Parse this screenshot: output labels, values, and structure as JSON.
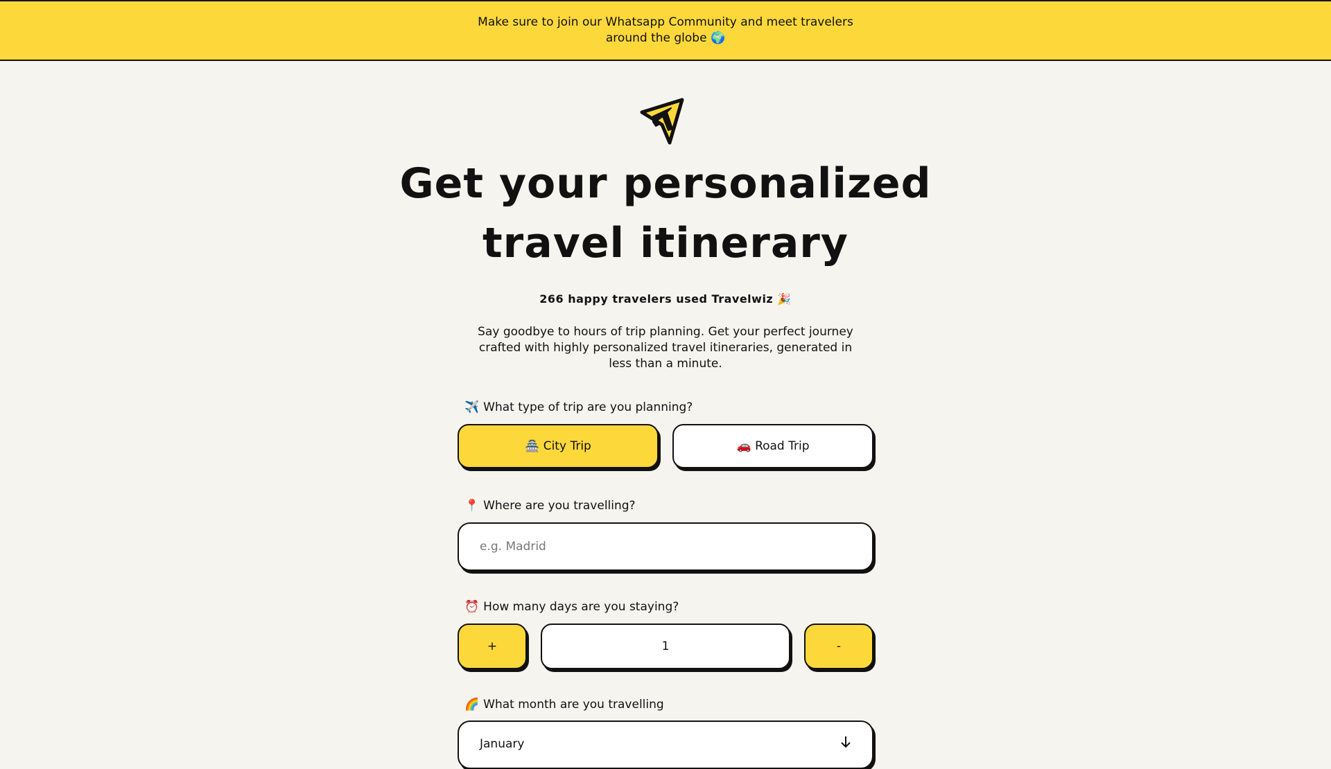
{
  "banner": {
    "text": "Make sure to join our Whatsapp Community and meet travelers around the globe 🌍"
  },
  "hero": {
    "title_line1": "Get your personalized",
    "title_line2": "travel itinerary",
    "count_text": "266 happy travelers used Travelwiz 🎉",
    "intro": "Say goodbye to hours of trip planning. Get your perfect journey crafted with highly personalized travel itineraries, generated in less than a minute."
  },
  "form": {
    "trip_type": {
      "emoji": "✈️",
      "label": "What type of trip are you planning?",
      "options": [
        {
          "emoji": "🏯",
          "label": "City Trip",
          "selected": true
        },
        {
          "emoji": "🚗",
          "label": "Road Trip",
          "selected": false
        }
      ]
    },
    "destination": {
      "emoji": "📍",
      "label": "Where are you travelling?",
      "placeholder": "e.g. Madrid",
      "value": ""
    },
    "days": {
      "emoji": "⏰",
      "label": "How many days are you staying?",
      "plus_label": "+",
      "minus_label": "-",
      "value": "1"
    },
    "month": {
      "emoji": "🌈",
      "label": "What month are you travelling",
      "selected": "January"
    }
  },
  "colors": {
    "accent": "#fdd83a",
    "background": "#f5f4ef",
    "ink": "#111111"
  }
}
